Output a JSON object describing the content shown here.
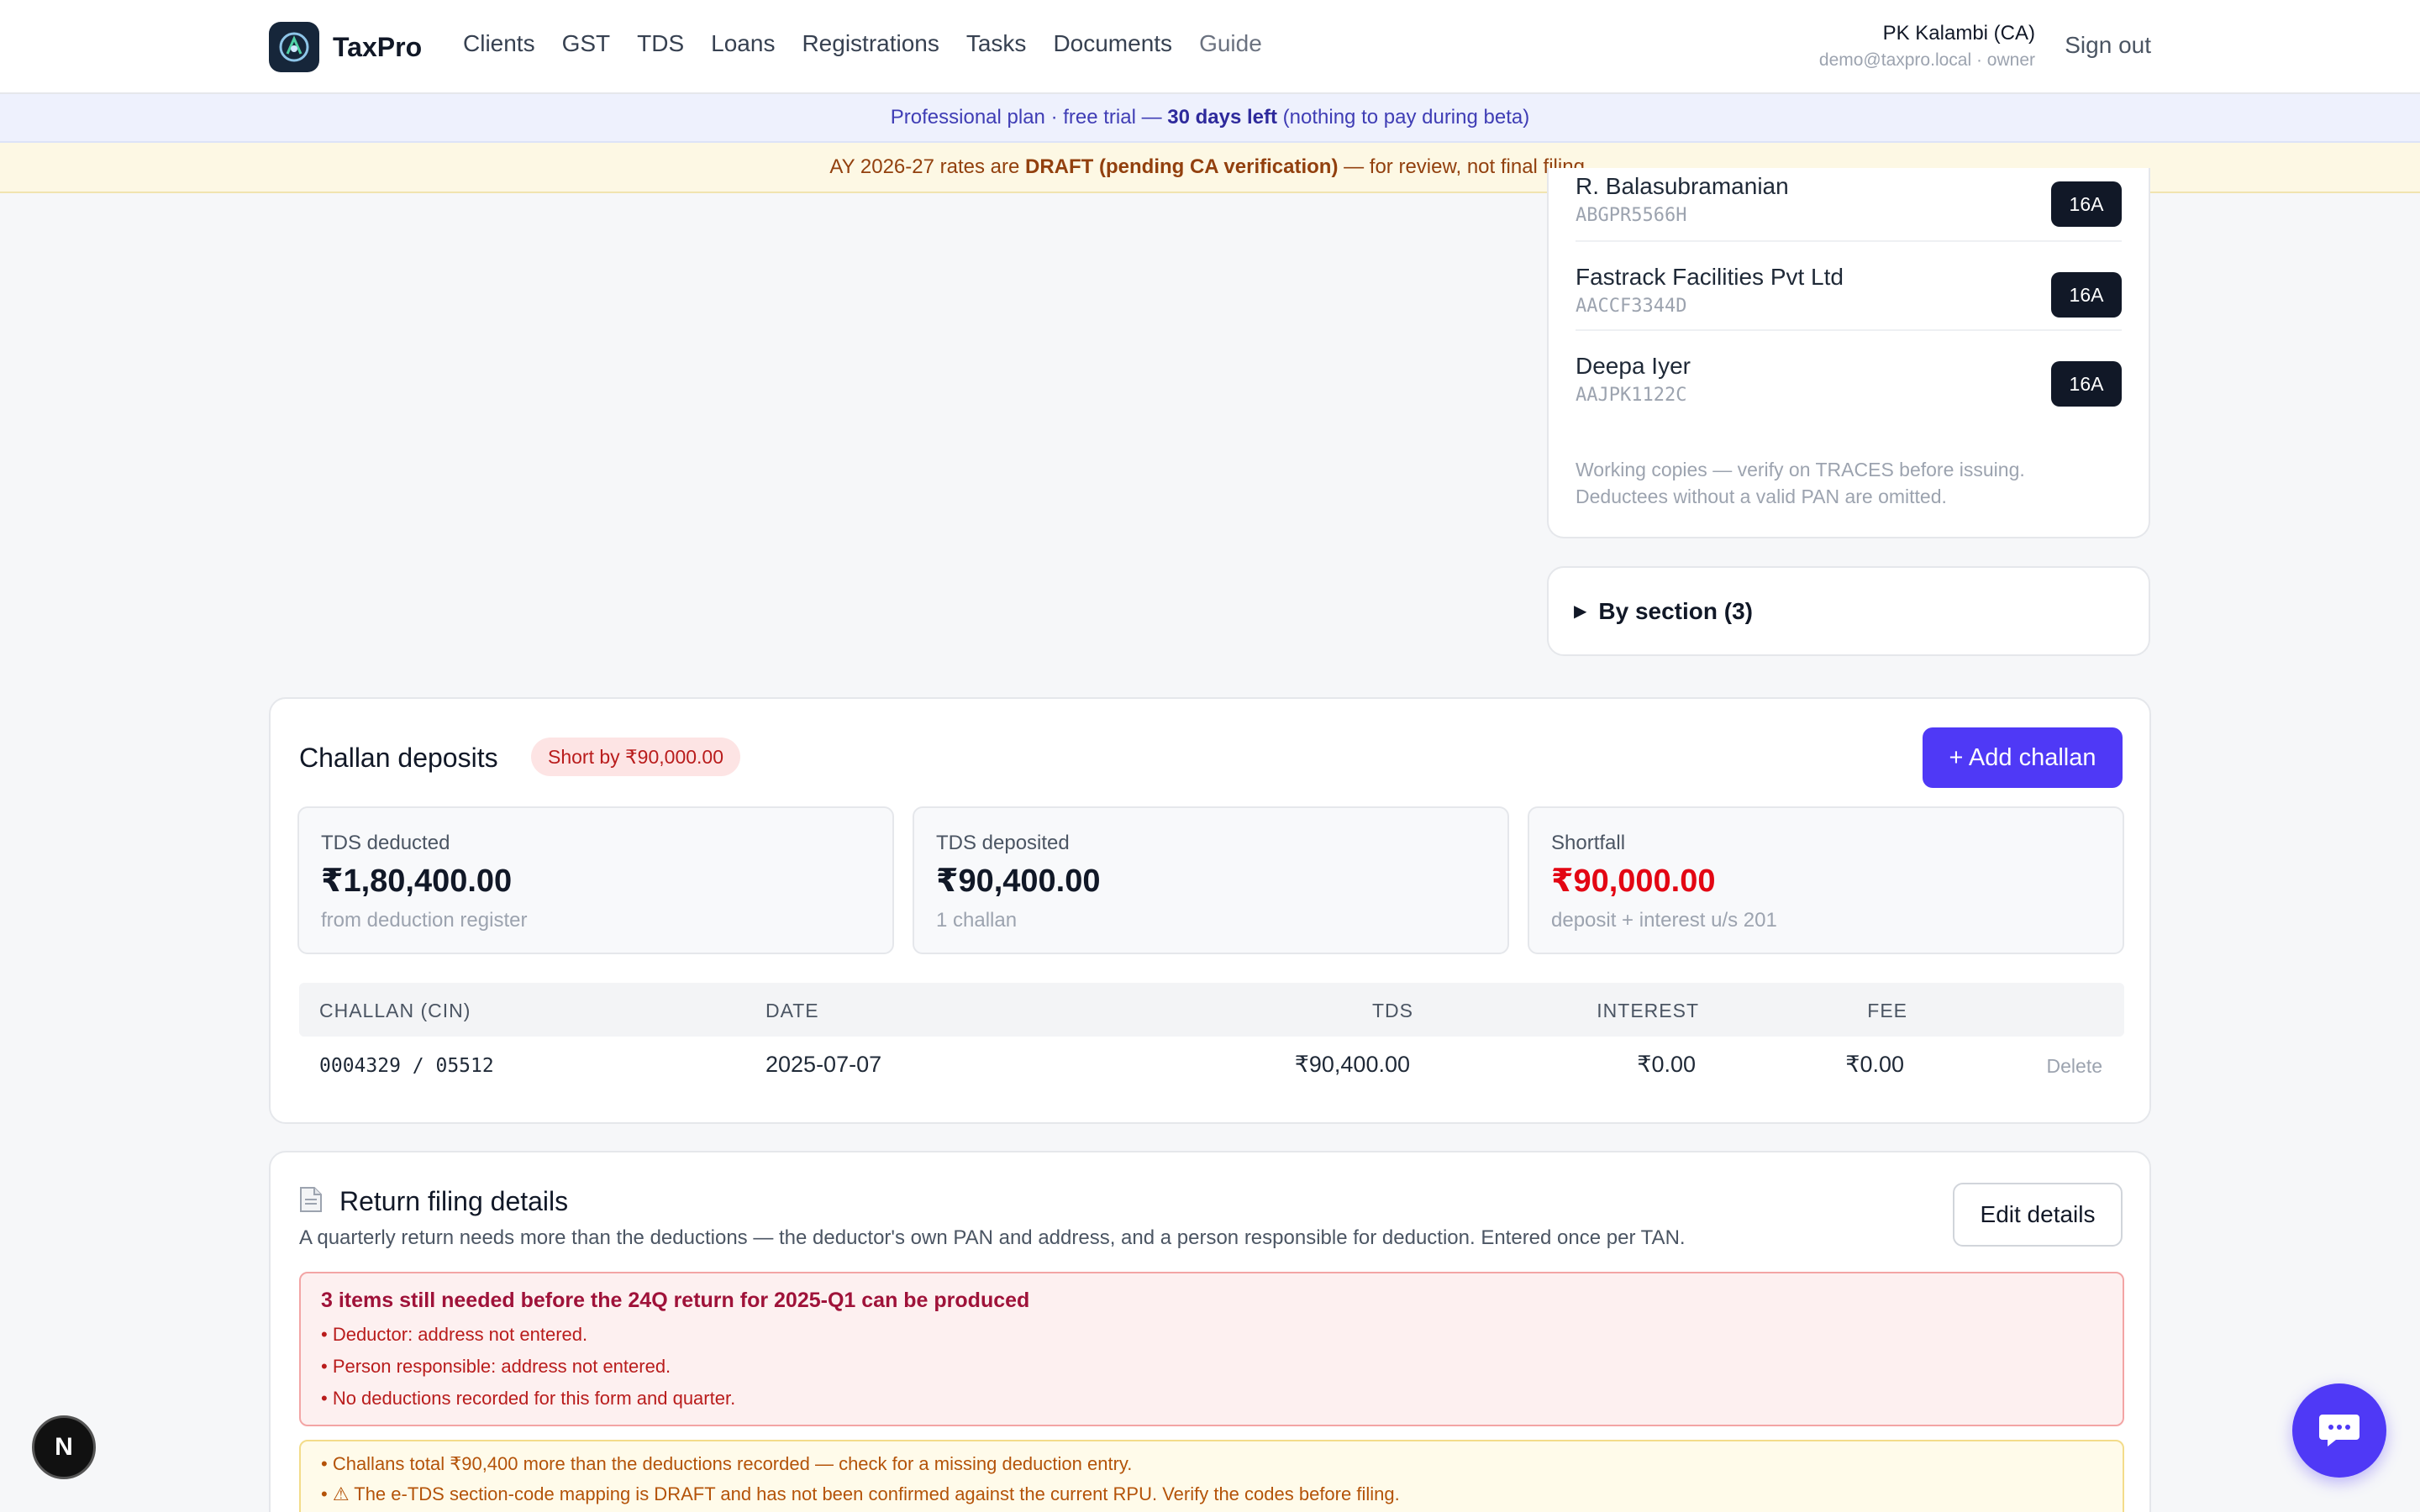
{
  "app": {
    "name": "TaxPro",
    "user_name": "PK Kalambi (CA)",
    "user_email": "demo@taxpro.local · owner",
    "sign_out": "Sign out"
  },
  "nav": [
    "Clients",
    "GST",
    "TDS",
    "Loans",
    "Registrations",
    "Tasks",
    "Documents",
    "Guide"
  ],
  "banners": {
    "plan_prefix": "Professional plan · free trial —",
    "plan_days": "30 days left",
    "plan_suffix": "(nothing to pay during beta)",
    "draft_prefix": "AY 2026-27 rates are",
    "draft_bold": "DRAFT (pending CA verification)",
    "draft_suffix": "— for review, not final filing."
  },
  "deductees": [
    {
      "name": "R. Balasubramanian",
      "pan": "ABGPR5566H",
      "action": "16A"
    },
    {
      "name": "Fastrack Facilities Pvt Ltd",
      "pan": "AACCF3344D",
      "action": "16A"
    },
    {
      "name": "Deepa Iyer",
      "pan": "AAJPK1122C",
      "action": "16A"
    }
  ],
  "deductee_note_1": "Working copies — verify on TRACES before issuing.",
  "deductee_note_2": "Deductees without a valid PAN are omitted.",
  "by_section": "By section (3)",
  "challan": {
    "title": "Challan deposits",
    "badge": "Short by ₹90,000.00",
    "add_button": "+ Add challan",
    "stats": [
      {
        "label": "TDS deducted",
        "value": "₹1,80,400.00",
        "sub": "from deduction register"
      },
      {
        "label": "TDS deposited",
        "value": "₹90,400.00",
        "sub": "1 challan"
      },
      {
        "label": "Shortfall",
        "value": "₹90,000.00",
        "sub": "deposit + interest u/s 201"
      }
    ],
    "columns": [
      "CHALLAN (CIN)",
      "DATE",
      "TDS",
      "INTEREST",
      "FEE"
    ],
    "rows": [
      {
        "cin": "0004329 / 05512",
        "date": "2025-07-07",
        "tds": "₹90,400.00",
        "interest": "₹0.00",
        "fee": "₹0.00",
        "action": "Delete"
      }
    ]
  },
  "return_filing": {
    "title": "Return filing details",
    "description": "A quarterly return needs more than the deductions — the deductor's own PAN and address, and a person responsible for deduction. Entered once per TAN.",
    "edit_button": "Edit details",
    "alert_title": "3 items still needed before the 24Q return for 2025-Q1 can be produced",
    "alert_items": [
      "• Deductor: address not entered.",
      "• Person responsible: address not entered.",
      "• No deductions recorded for this form and quarter."
    ],
    "warnings": [
      "• Challans total ₹90,400 more than the deductions recorded — check for a missing deduction entry.",
      "• ⚠ The e-TDS section-code mapping is DRAFT and has not been confirmed against the current RPU. Verify the codes before filing."
    ]
  },
  "floating": {
    "next_badge": "N"
  },
  "colors": {
    "accent": "#4f39f6",
    "danger": "#e30613",
    "dark": "#111827"
  }
}
